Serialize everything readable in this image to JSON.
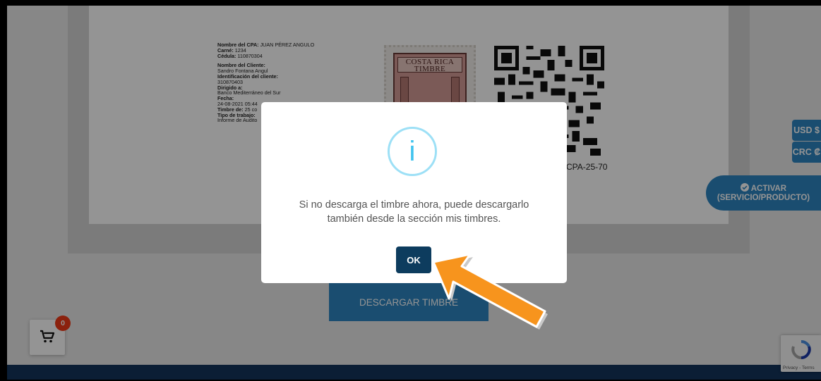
{
  "document": {
    "cpa_name_label": "Nombre del CPA:",
    "cpa_name": "JUAN PÉREZ ANGULO",
    "carne_label": "Carné:",
    "carne": "1234",
    "cedula_label": "Cédula:",
    "cedula": "110870304",
    "client_name_label": "Nombre del Cliente:",
    "client_name": "Sandro Fontana Angul",
    "client_id_label": "Identificación del cliente:",
    "client_id": "310870403",
    "directed_label": "Dirigido a:",
    "directed_to": "Banco Mediterráneo del Sur",
    "date_label": "Fecha:",
    "date": "24-08-2021 05:44",
    "stamp_of_label": "Timbre de:",
    "stamp_of": "25 co",
    "work_type_label": "Tipo de trabajo:",
    "work_type": "Informe de Audito",
    "stamp_title_line1": "COSTA RICA",
    "stamp_title_line2": "TIMBRE",
    "qr_code_caption": "CPA-25-70",
    "download_button": "DESCARGAR TIMBRE"
  },
  "cart": {
    "count": "0",
    "icon": "cart-icon"
  },
  "currency": {
    "usd": "USD $",
    "crc": "CRC ₡"
  },
  "activate": {
    "line1": "ACTIVAR",
    "line2": "(SERVICIO/PRODUCTO)",
    "icon": "check-circle-icon"
  },
  "recaptcha": {
    "text": "Privacy - Terms"
  },
  "modal": {
    "icon": "info-icon",
    "icon_char": "i",
    "message_line1": "Si no descarga el timbre ahora, puede descargarlo",
    "message_line2": "también desde la sección mis timbres.",
    "ok_button": "OK"
  },
  "colors": {
    "accent": "#2e86c1",
    "ok_button": "#0d3c5e",
    "info": "#3fc3ee",
    "arrow": "#f7941d",
    "badge": "#f03a17",
    "footer": "#13345c"
  }
}
